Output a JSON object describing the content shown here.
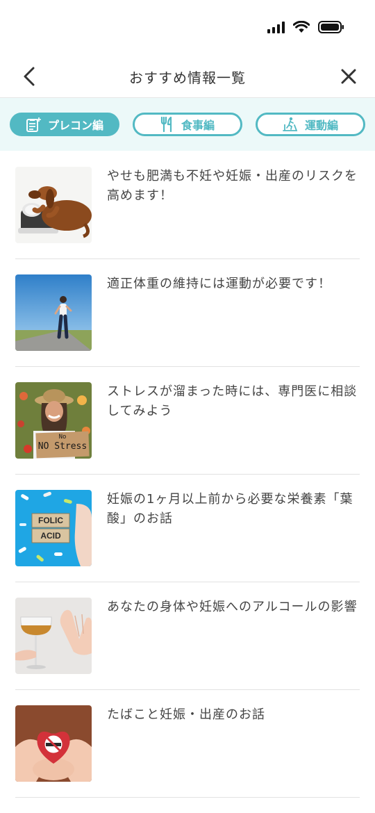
{
  "header": {
    "title": "おすすめ情報一覧"
  },
  "tabs": [
    {
      "label": "プレコン編",
      "icon": "checklist-icon",
      "active": true
    },
    {
      "label": "食事編",
      "icon": "utensils-icon",
      "active": false
    },
    {
      "label": "運動編",
      "icon": "treadmill-icon",
      "active": false
    }
  ],
  "articles": [
    {
      "title": "やせも肥満も不妊や妊娠・出産のリスクを高めます！",
      "thumb": "dog-on-scale"
    },
    {
      "title": "適正体重の維持には運動が必要です！",
      "thumb": "woman-running"
    },
    {
      "title": "ストレスが溜まった時には、専門医に相談してみよう",
      "thumb": "no-stress-sign",
      "sign_line1": "No",
      "sign_line2": "NO Stress"
    },
    {
      "title": "妊娠の1ヶ月以上前から必要な栄養素「葉酸」のお話",
      "thumb": "folic-acid-blocks",
      "block_line1": "FOLIC",
      "block_line2": "ACID"
    },
    {
      "title": "あなたの身体や妊娠へのアルコールの影響",
      "thumb": "wine-glass-refuse"
    },
    {
      "title": "たばこと妊娠・出産のお話",
      "thumb": "no-smoking-heart"
    }
  ],
  "colors": {
    "accent": "#52b9c3",
    "tab_bar_bg": "#ecf9f9"
  }
}
